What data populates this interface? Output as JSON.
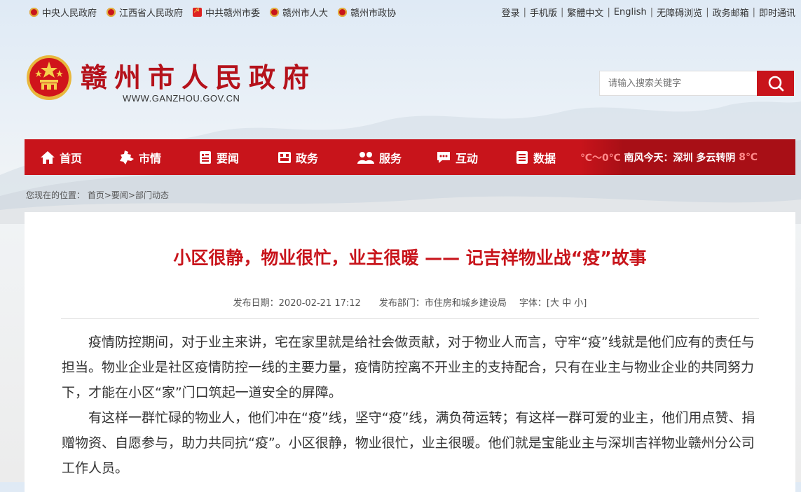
{
  "top_links": [
    {
      "label": "中央人民政府",
      "icon": "national-emblem-icon"
    },
    {
      "label": "江西省人民政府",
      "icon": "national-emblem-icon"
    },
    {
      "label": "中共赣州市委",
      "icon": "party-emblem-icon"
    },
    {
      "label": "赣州市人大",
      "icon": "national-emblem-icon"
    },
    {
      "label": "赣州市政协",
      "icon": "cppcc-emblem-icon"
    }
  ],
  "right_links": [
    "登录",
    "手机版",
    "繁體中文",
    "English",
    "无障碍浏览",
    "政务邮箱",
    "即时通讯"
  ],
  "site": {
    "title": "赣州市人民政府",
    "url": "WWW.GANZHOU.GOV.CN"
  },
  "search": {
    "placeholder": "请输入搜索关键字",
    "icon": "search-icon"
  },
  "nav": [
    {
      "label": "首页",
      "icon": "home-icon"
    },
    {
      "label": "市情",
      "icon": "map-icon"
    },
    {
      "label": "要闻",
      "icon": "news-icon"
    },
    {
      "label": "政务",
      "icon": "gov-affairs-icon"
    },
    {
      "label": "服务",
      "icon": "service-icon"
    },
    {
      "label": "互动",
      "icon": "chat-icon"
    },
    {
      "label": "数据",
      "icon": "data-icon"
    }
  ],
  "weather": {
    "prefix_temp": "℃～0℃",
    "prefix_wind": "南风",
    "today_label": "今天：",
    "city": "深圳",
    "condition": "多云转阴",
    "suffix_temp": "8℃"
  },
  "breadcrumb": {
    "prefix": "您现在的位置：",
    "items": [
      "首页",
      "要闻",
      "部门动态"
    ],
    "separator": ">"
  },
  "article": {
    "title": "小区很静，物业很忙，业主很暖 —— 记吉祥物业战“疫”故事",
    "date_label": "发布日期：",
    "date": "2020-02-21 17:12",
    "dept_label": "发布部门：",
    "dept": "市住房和城乡建设局",
    "font_label": "字体：",
    "font_sizes": [
      "大",
      "中",
      "小"
    ],
    "paragraphs": [
      "疫情防控期间，对于业主来讲，宅在家里就是给社会做贡献，对于物业人而言，守牢“疫”线就是他们应有的责任与担当。物业企业是社区疫情防控一线的主要力量，疫情防控离不开业主的支持配合，只有在业主与物业企业的共同努力下，才能在小区“家”门口筑起一道安全的屏障。",
      "有这样一群忙碌的物业人，他们冲在“疫”线，坚守“疫”线，满负荷运转；有这样一群可爱的业主，他们用点赞、捐赠物资、自愿参与，助力共同抗“疫”。小区很静，物业很忙，业主很暖。他们就是宝能业主与深圳吉祥物业赣州分公司工作人员。"
    ]
  },
  "colors": {
    "brand_red": "#c8141b"
  }
}
